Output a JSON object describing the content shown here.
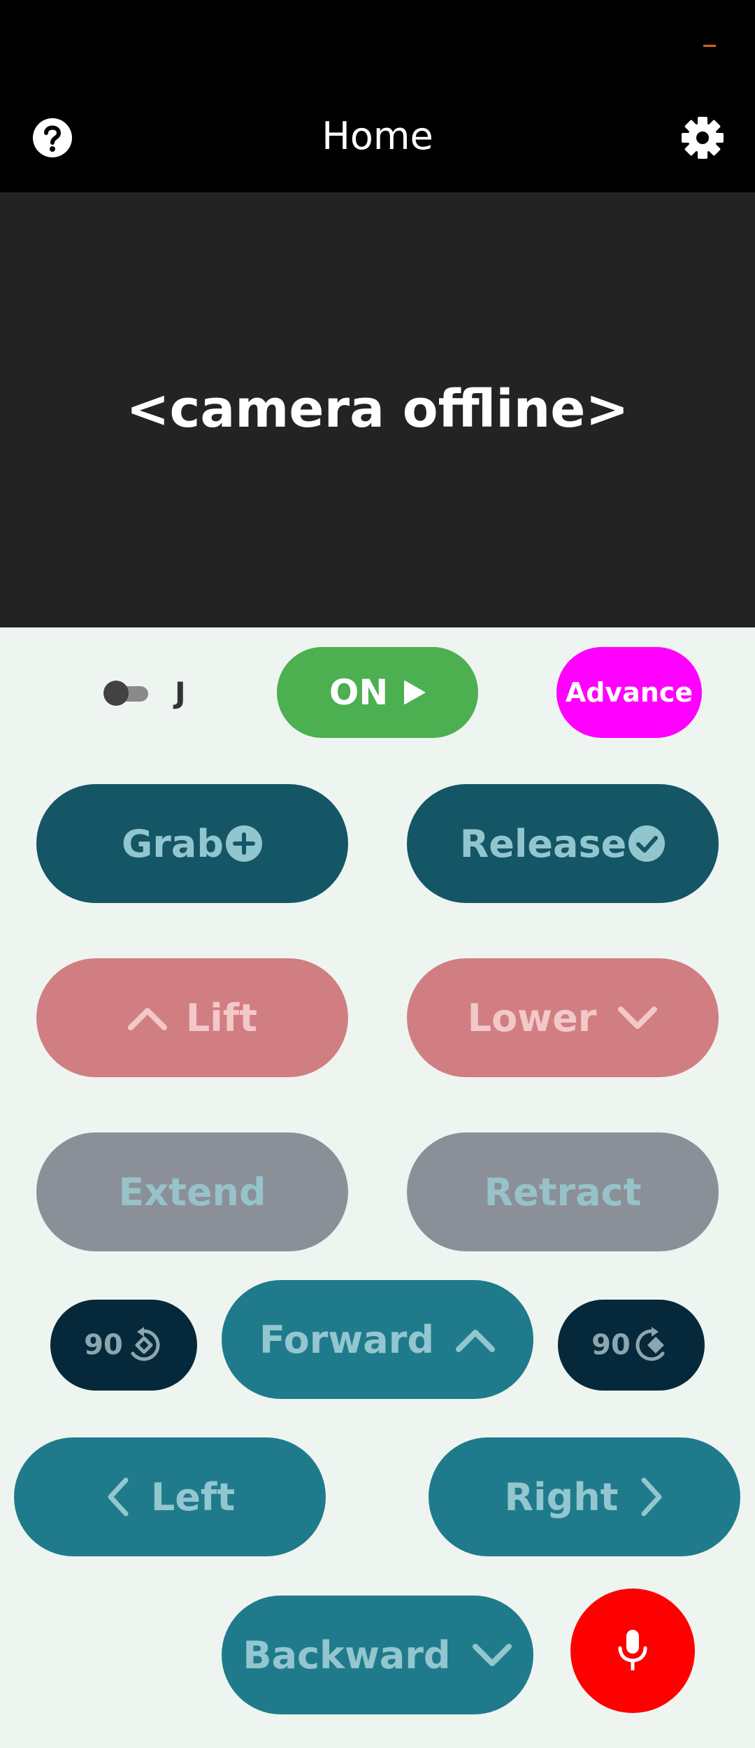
{
  "app": {
    "title": "Home"
  },
  "camera": {
    "status_text": "<camera offline>"
  },
  "toggle": {
    "label": "J",
    "state": "off"
  },
  "top_buttons": {
    "on": "ON",
    "advance": "Advance"
  },
  "gripper": {
    "grab": "Grab",
    "release": "Release"
  },
  "vertical": {
    "lift": "Lift",
    "lower": "Lower"
  },
  "arm": {
    "extend": "Extend",
    "retract": "Retract"
  },
  "rotate": {
    "left_label": "90",
    "right_label": "90"
  },
  "drive": {
    "forward": "Forward",
    "left": "Left",
    "right": "Right",
    "backward": "Backward"
  },
  "colors": {
    "status_bar": "#000000",
    "camera_bg": "#232323",
    "page_bg": "#eef5f1",
    "on_green": "#4caf50",
    "advance_magenta": "#ff00ff",
    "gripper_dark_teal": "#145566",
    "vertical_red": "#d17e82",
    "arm_grey": "#8b9098",
    "drive_teal": "#1f7b8b",
    "rotate_navy": "#05293a",
    "mic_red": "#ff0000"
  },
  "icons": [
    "help-icon",
    "settings-gear-icon",
    "play-icon",
    "plus-circle-icon",
    "check-circle-icon",
    "chevron-up-icon",
    "chevron-down-icon",
    "rotate-left-icon",
    "rotate-right-icon",
    "chevron-left-icon",
    "chevron-right-icon",
    "microphone-icon"
  ]
}
